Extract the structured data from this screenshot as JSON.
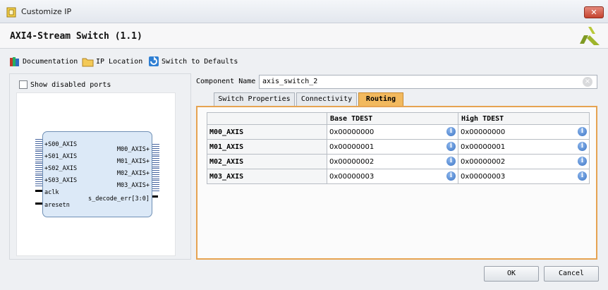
{
  "window": {
    "title": "Customize IP",
    "close_symbol": "✕"
  },
  "ip": {
    "title": "AXI4-Stream Switch (1.1)"
  },
  "toolbar": {
    "documentation": "Documentation",
    "ip_location": "IP Location",
    "switch_defaults": "Switch to Defaults"
  },
  "left": {
    "show_disabled_ports": "Show disabled ports",
    "symbol": {
      "left_ports": [
        "S00_AXIS",
        "S01_AXIS",
        "S02_AXIS",
        "S03_AXIS"
      ],
      "right_ports": [
        "M00_AXIS",
        "M01_AXIS",
        "M02_AXIS",
        "M03_AXIS"
      ],
      "aclk": "aclk",
      "aresetn": "aresetn",
      "decode_err": "s_decode_err[3:0]",
      "plus": "+"
    }
  },
  "component": {
    "label": "Component Name",
    "value": "axis_switch_2",
    "clear_symbol": "×"
  },
  "tabs": [
    {
      "label": "Switch Properties",
      "active": false
    },
    {
      "label": "Connectivity",
      "active": false
    },
    {
      "label": "Routing",
      "active": true
    }
  ],
  "routing": {
    "headers": [
      "",
      "Base TDEST",
      "High TDEST"
    ],
    "info_symbol": "i",
    "rows": [
      {
        "name": "M00_AXIS",
        "base": "0x00000000",
        "high": "0x00000000"
      },
      {
        "name": "M01_AXIS",
        "base": "0x00000001",
        "high": "0x00000001"
      },
      {
        "name": "M02_AXIS",
        "base": "0x00000002",
        "high": "0x00000002"
      },
      {
        "name": "M03_AXIS",
        "base": "0x00000003",
        "high": "0x00000003"
      }
    ]
  },
  "buttons": {
    "ok": "OK",
    "cancel": "Cancel"
  }
}
